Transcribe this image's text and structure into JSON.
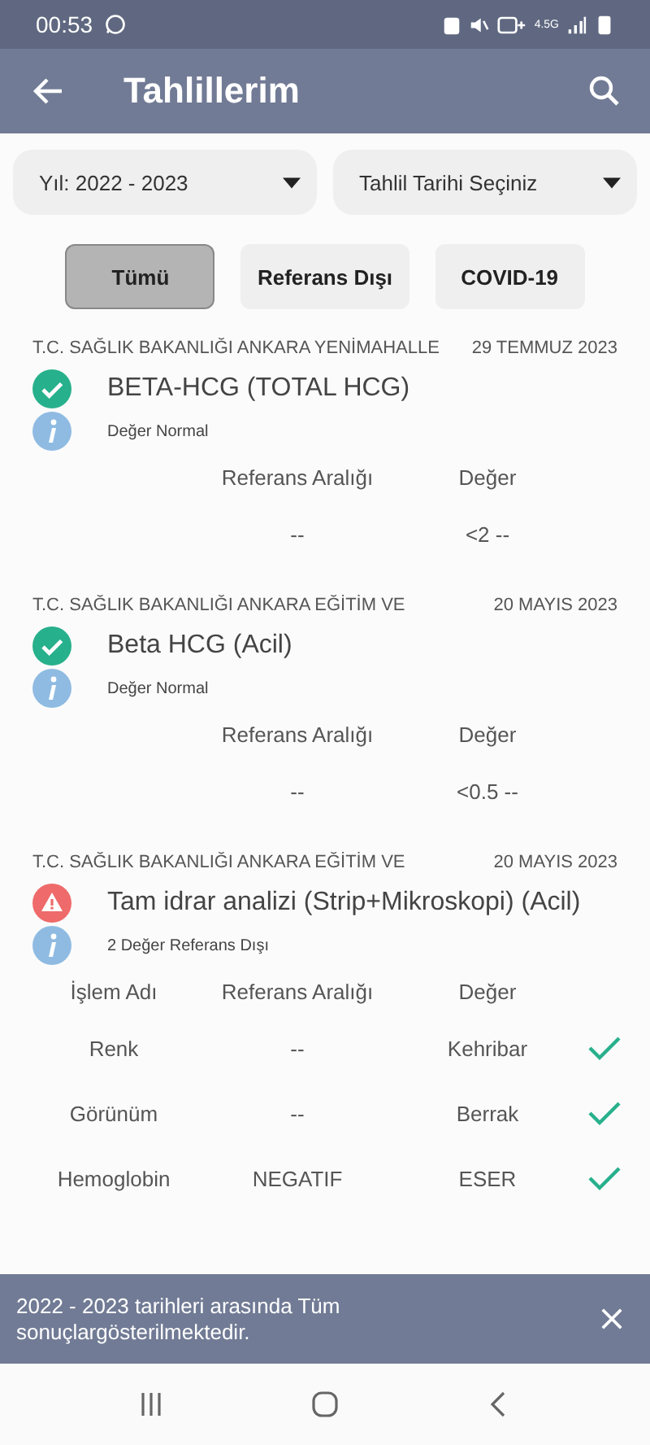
{
  "status_bar": {
    "time": "00:53",
    "network": "4.5G"
  },
  "app_bar": {
    "title": "Tahlillerim"
  },
  "dropdowns": [
    {
      "label": "Yıl: 2022 - 2023"
    },
    {
      "label": "Tahlil Tarihi Seçiniz"
    }
  ],
  "filters": [
    {
      "label": "Tümü",
      "selected": true
    },
    {
      "label": "Referans Dışı",
      "selected": false
    },
    {
      "label": "COVID-19",
      "selected": false
    }
  ],
  "results": [
    {
      "institution": "T.C. SAĞLIK BAKANLIĞI ANKARA YENİMAHALLE",
      "date": "29 TEMMUZ 2023",
      "kind": "normal",
      "name": "BETA-HCG (TOTAL HCG)",
      "summary": "Değer Normal",
      "headers": {
        "reference": "Referans Aralığı",
        "value": "Değer"
      },
      "rows": [
        {
          "reference": "--",
          "value": "<2 --",
          "checked": false
        }
      ]
    },
    {
      "institution": "T.C. SAĞLIK BAKANLIĞI ANKARA EĞİTİM VE",
      "date": "20 MAYIS 2023",
      "kind": "normal",
      "name": "Beta HCG (Acil)",
      "summary": "Değer Normal",
      "headers": {
        "reference": "Referans Aralığı",
        "value": "Değer"
      },
      "rows": [
        {
          "reference": "--",
          "value": "<0.5 --",
          "checked": false
        }
      ]
    },
    {
      "institution": "T.C. SAĞLIK BAKANLIĞI ANKARA EĞİTİM VE",
      "date": "20 MAYIS 2023",
      "kind": "abnormal",
      "name": "Tam idrar analizi (Strip+Mikroskopi) (Acil)",
      "summary": "2 Değer Referans Dışı",
      "headers": {
        "name": "İşlem Adı",
        "reference": "Referans Aralığı",
        "value": "Değer"
      },
      "rows": [
        {
          "name": "Renk",
          "reference": "--",
          "value": "Kehribar",
          "checked": true
        },
        {
          "name": "Görünüm",
          "reference": "--",
          "value": "Berrak",
          "checked": true
        },
        {
          "name": "Hemoglobin",
          "reference": "NEGATIF",
          "value": "ESER",
          "checked": true
        }
      ]
    }
  ],
  "snackbar": {
    "message": "2022 - 2023 tarihleri arasında Tüm sonuçlargösterilmektedir."
  }
}
